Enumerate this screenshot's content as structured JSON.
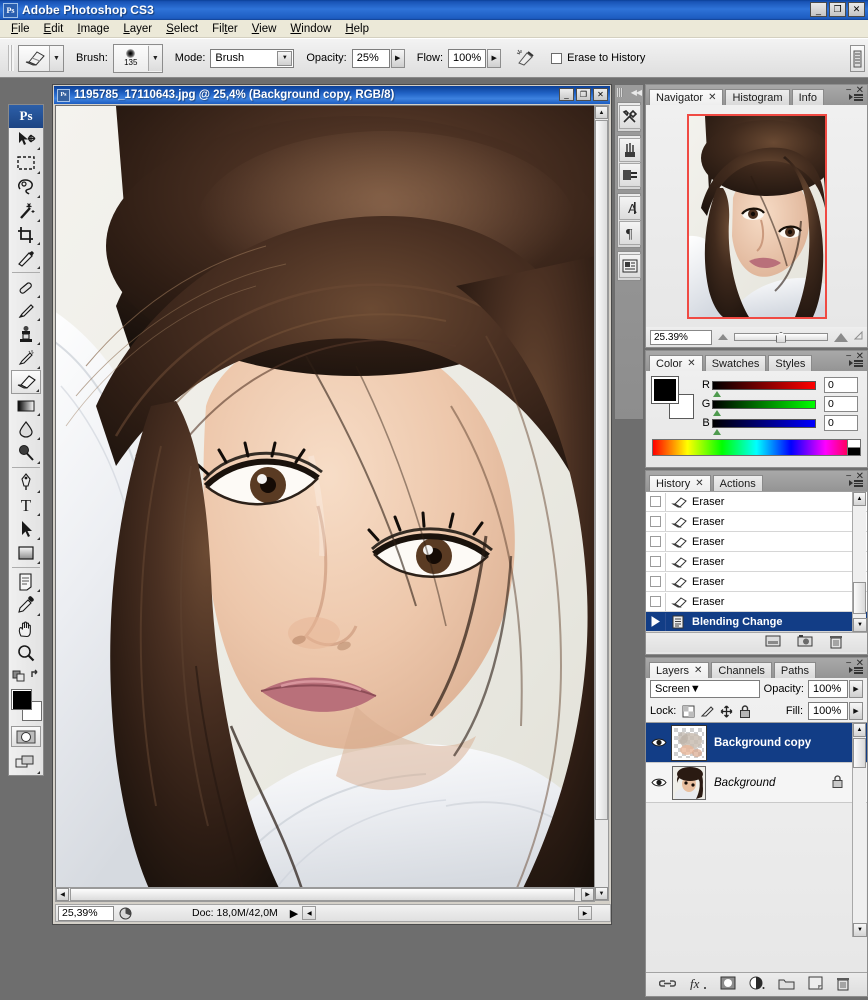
{
  "app": {
    "title": "Adobe Photoshop CS3",
    "logo": "ps-logo",
    "window_buttons": {
      "minimize": "_",
      "maximize": "❐",
      "close": "✕"
    }
  },
  "menubar": {
    "items": [
      {
        "label": "File",
        "mnemonic": "F"
      },
      {
        "label": "Edit",
        "mnemonic": "E"
      },
      {
        "label": "Image",
        "mnemonic": "I"
      },
      {
        "label": "Layer",
        "mnemonic": "L"
      },
      {
        "label": "Select",
        "mnemonic": "S"
      },
      {
        "label": "Filter",
        "mnemonic": "t"
      },
      {
        "label": "View",
        "mnemonic": "V"
      },
      {
        "label": "Window",
        "mnemonic": "W"
      },
      {
        "label": "Help",
        "mnemonic": "H"
      }
    ]
  },
  "options_bar": {
    "active_tool": "eraser-tool",
    "brush_label": "Brush:",
    "brush_size": "135",
    "mode_label": "Mode:",
    "mode_value": "Brush",
    "opacity_label": "Opacity:",
    "opacity_value": "25%",
    "flow_label": "Flow:",
    "flow_value": "100%",
    "airbrush_icon": "airbrush-icon",
    "erase_to_history_label": "Erase to History",
    "erase_to_history_checked": false,
    "palette_well_icon": "palette-well-icon"
  },
  "toolbox": {
    "logo": "Ps",
    "tools": [
      {
        "name": "move-tool",
        "glyph": "move"
      },
      {
        "name": "rectangular-marquee-tool",
        "glyph": "marquee"
      },
      {
        "name": "lasso-tool",
        "glyph": "lasso"
      },
      {
        "name": "magic-wand-tool",
        "glyph": "wand"
      },
      {
        "name": "crop-tool",
        "glyph": "crop"
      },
      {
        "name": "slice-tool",
        "glyph": "slice"
      },
      {
        "name": "healing-brush-tool",
        "glyph": "heal"
      },
      {
        "name": "brush-tool",
        "glyph": "brush"
      },
      {
        "name": "clone-stamp-tool",
        "glyph": "stamp"
      },
      {
        "name": "history-brush-tool",
        "glyph": "historybrush"
      },
      {
        "name": "eraser-tool",
        "glyph": "eraser",
        "selected": true
      },
      {
        "name": "gradient-tool",
        "glyph": "gradient"
      },
      {
        "name": "blur-tool",
        "glyph": "blur"
      },
      {
        "name": "dodge-tool",
        "glyph": "dodge"
      },
      {
        "name": "pen-tool",
        "glyph": "pen"
      },
      {
        "name": "type-tool",
        "glyph": "type"
      },
      {
        "name": "path-selection-tool",
        "glyph": "arrow"
      },
      {
        "name": "rectangle-shape-tool",
        "glyph": "shape"
      },
      {
        "name": "notes-tool",
        "glyph": "notes"
      },
      {
        "name": "eyedropper-tool",
        "glyph": "eyedropper"
      },
      {
        "name": "hand-tool",
        "glyph": "hand"
      },
      {
        "name": "zoom-tool",
        "glyph": "zoom"
      }
    ],
    "foreground_color": "#000000",
    "background_color": "#ffffff",
    "quick_mask_icon": "quick-mask-icon",
    "screen_mode_icon": "screen-mode-icon"
  },
  "document": {
    "title": "1195785_17110643.jpg @ 25,4% (Background copy, RGB/8)",
    "window_buttons": {
      "minimize": "_",
      "maximize": "❐",
      "close": "✕"
    },
    "status": {
      "zoom": "25,39%",
      "doc_info": "Doc: 18,0M/42,0M",
      "preview_icon": "doc-size-icon"
    }
  },
  "icon_dock": {
    "collapse_icon": "collapse-dock-icon",
    "buttons": [
      {
        "name": "tool-presets-icon",
        "glyph": "tools"
      },
      {
        "name": "brushes-icon",
        "glyph": "brushes"
      },
      {
        "name": "clone-source-icon",
        "glyph": "clonesource"
      },
      {
        "name": "character-icon",
        "glyph": "character"
      },
      {
        "name": "paragraph-icon",
        "glyph": "paragraph"
      },
      {
        "name": "layer-comps-icon",
        "glyph": "layercomps"
      }
    ]
  },
  "navigator_panel": {
    "tabs": [
      {
        "label": "Navigator",
        "active": true,
        "closable": true
      },
      {
        "label": "Histogram",
        "active": false
      },
      {
        "label": "Info",
        "active": false
      }
    ],
    "zoom_value": "25.39%",
    "view_box_color": "#f04a43",
    "zoom_out_icon": "zoom-out-icon",
    "zoom_in_icon": "zoom-in-icon"
  },
  "color_panel": {
    "tabs": [
      {
        "label": "Color",
        "active": true,
        "closable": true
      },
      {
        "label": "Swatches",
        "active": false
      },
      {
        "label": "Styles",
        "active": false
      }
    ],
    "foreground_color": "#000000",
    "background_color": "#ffffff",
    "channels": [
      {
        "label": "R",
        "value": "0",
        "ramp_to": "#ff0000"
      },
      {
        "label": "G",
        "value": "0",
        "ramp_to": "#00ff00"
      },
      {
        "label": "B",
        "value": "0",
        "ramp_to": "#0000ff"
      }
    ]
  },
  "history_panel": {
    "tabs": [
      {
        "label": "History",
        "active": true,
        "closable": true
      },
      {
        "label": "Actions",
        "active": false
      }
    ],
    "entries": [
      {
        "label": "Eraser",
        "icon": "eraser-icon",
        "selected": false
      },
      {
        "label": "Eraser",
        "icon": "eraser-icon",
        "selected": false
      },
      {
        "label": "Eraser",
        "icon": "eraser-icon",
        "selected": false
      },
      {
        "label": "Eraser",
        "icon": "eraser-icon",
        "selected": false
      },
      {
        "label": "Eraser",
        "icon": "eraser-icon",
        "selected": false
      },
      {
        "label": "Eraser",
        "icon": "eraser-icon",
        "selected": false
      },
      {
        "label": "Blending Change",
        "icon": "blending-change-icon",
        "selected": true
      }
    ],
    "footer_buttons": [
      {
        "name": "create-document-from-state-button",
        "glyph": "doc"
      },
      {
        "name": "create-snapshot-button",
        "glyph": "snapshot"
      },
      {
        "name": "delete-state-button",
        "glyph": "trash"
      }
    ]
  },
  "layers_panel": {
    "tabs": [
      {
        "label": "Layers",
        "active": true,
        "closable": true
      },
      {
        "label": "Channels",
        "active": false
      },
      {
        "label": "Paths",
        "active": false
      }
    ],
    "blend_mode": "Screen",
    "opacity_label": "Opacity:",
    "opacity_value": "100%",
    "lock_label": "Lock:",
    "lock_buttons": [
      {
        "name": "lock-transparent-pixels-button",
        "glyph": "checker"
      },
      {
        "name": "lock-image-pixels-button",
        "glyph": "brush"
      },
      {
        "name": "lock-position-button",
        "glyph": "move"
      },
      {
        "name": "lock-all-button",
        "glyph": "lock"
      }
    ],
    "fill_label": "Fill:",
    "fill_value": "100%",
    "layers": [
      {
        "name": "Background copy",
        "selected": true,
        "visible": true,
        "locked": false,
        "italic": false
      },
      {
        "name": "Background",
        "selected": false,
        "visible": true,
        "locked": true,
        "italic": true
      }
    ],
    "footer_buttons": [
      {
        "name": "link-layers-button",
        "glyph": "link"
      },
      {
        "name": "layer-style-button",
        "glyph": "fx"
      },
      {
        "name": "layer-mask-button",
        "glyph": "mask"
      },
      {
        "name": "new-adjustment-layer-button",
        "glyph": "adjust"
      },
      {
        "name": "new-group-button",
        "glyph": "folder"
      },
      {
        "name": "new-layer-button",
        "glyph": "newlayer"
      },
      {
        "name": "delete-layer-button",
        "glyph": "trash"
      }
    ]
  }
}
